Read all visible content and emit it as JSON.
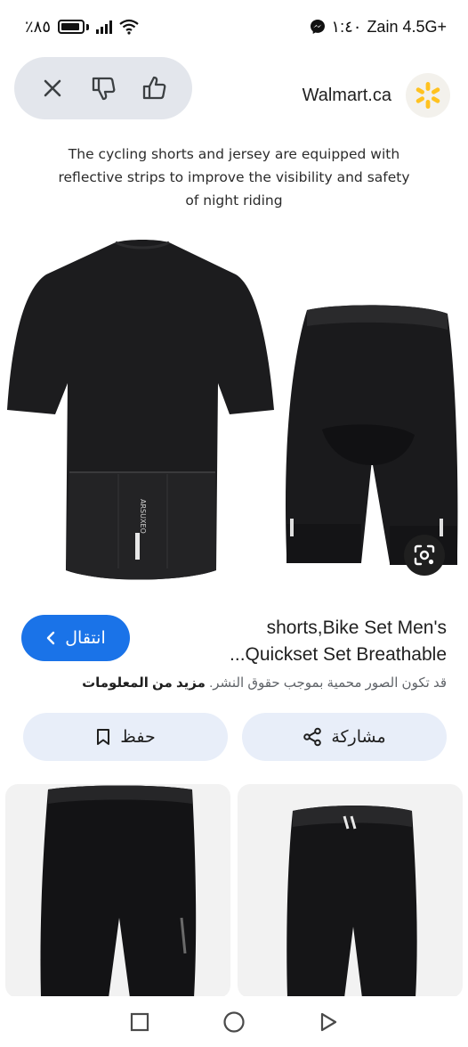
{
  "status_bar": {
    "battery": "٪٨٥",
    "carrier": "Zain 4.5G+",
    "time": "١:٤٠"
  },
  "header": {
    "source_name": "Walmart.ca"
  },
  "image": {
    "caption": "The cycling shorts and jersey are equipped with reflective strips to improve the visibility and safety of night riding",
    "jersey_print": "ARSUXEO"
  },
  "product": {
    "title_line1": "shorts,Bike Set Men's",
    "title_line2": "...Quickset Set Breathable",
    "visit_label": "انتقال",
    "notice_text": "قد تكون الصور محمية بموجب حقوق النشر.",
    "notice_link": "مزيد من المعلومات"
  },
  "actions": {
    "share_label": "مشاركة",
    "save_label": "حفظ"
  },
  "colors": {
    "accent": "#1a73e8",
    "pill_bg": "#e8eef9",
    "walmart_yellow": "#ffc220"
  },
  "icons": [
    "close-icon",
    "thumbs-down-icon",
    "thumbs-up-icon",
    "walmart-spark-icon",
    "lens-search-icon",
    "chevron-left-icon",
    "share-icon",
    "bookmark-icon",
    "square-nav-icon",
    "circle-nav-icon",
    "triangle-nav-icon"
  ]
}
